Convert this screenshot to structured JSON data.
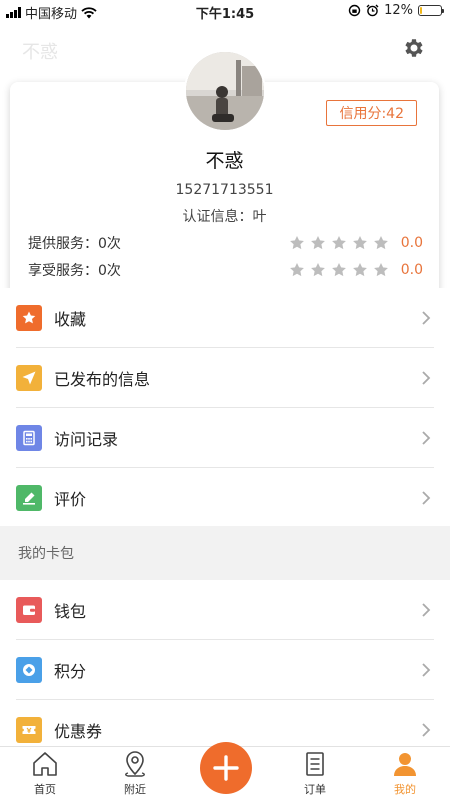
{
  "status_bar": {
    "carrier": "中国移动",
    "time": "下午1:45",
    "battery": "12%",
    "battery_level": 0.12
  },
  "header": {
    "nickname_faded": "不惑"
  },
  "profile": {
    "credit": "信用分:42",
    "name": "不惑",
    "phone": "15271713551",
    "cert": "认证信息：叶",
    "provide_label": "提供服务：0次",
    "provide_score": "0.0",
    "receive_label": "享受服务：0次",
    "receive_score": "0.0",
    "star_color_empty": "#bdbdbd",
    "accent": "#e8743b"
  },
  "menu": [
    {
      "label": "收藏",
      "icon": "star-icon",
      "color": "#ef6c2c"
    },
    {
      "label": "已发布的信息",
      "icon": "send-icon",
      "color": "#f2b13a"
    },
    {
      "label": "访问记录",
      "icon": "calculator-icon",
      "color": "#6f86e6"
    },
    {
      "label": "评价",
      "icon": "edit-icon",
      "color": "#4fb868"
    }
  ],
  "wallet_section": {
    "title": "我的卡包"
  },
  "wallet": [
    {
      "label": "钱包",
      "icon": "wallet-icon",
      "color": "#e85a5a"
    },
    {
      "label": "积分",
      "icon": "points-icon",
      "color": "#4aa0e8"
    },
    {
      "label": "优惠券",
      "icon": "coupon-icon",
      "color": "#f2b13a"
    }
  ],
  "tabs": [
    {
      "label": "首页",
      "icon": "home-icon"
    },
    {
      "label": "附近",
      "icon": "location-icon"
    },
    {
      "label": "",
      "icon": "plus-icon"
    },
    {
      "label": "订单",
      "icon": "order-icon"
    },
    {
      "label": "我的",
      "icon": "user-icon",
      "active": true
    }
  ]
}
